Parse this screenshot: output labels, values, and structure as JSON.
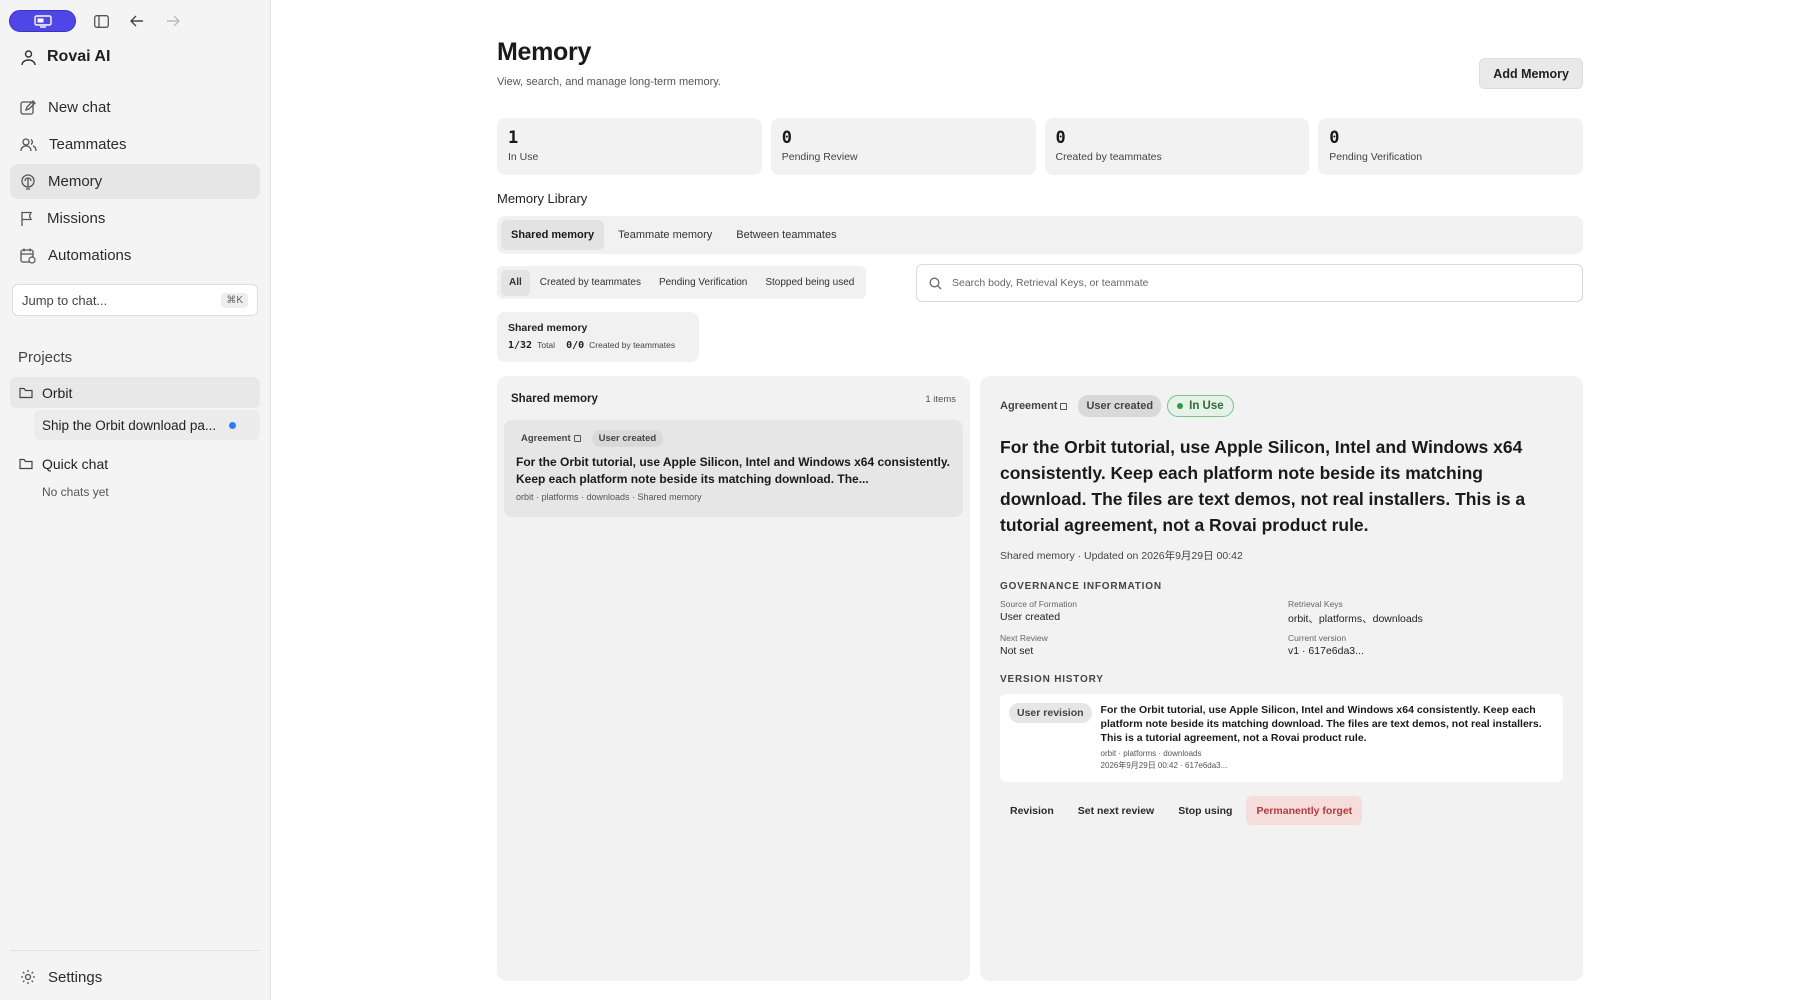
{
  "app": {
    "name": "Rovai AI"
  },
  "colors": {
    "accent": "#4f46e5",
    "in_use": "#2f9a47",
    "danger": "#b33a3a",
    "unread_dot": "#2f7cf6"
  },
  "sidebar": {
    "nav": [
      {
        "label": "New chat",
        "icon": "new-chat-icon"
      },
      {
        "label": "Teammates",
        "icon": "teammates-icon"
      },
      {
        "label": "Memory",
        "icon": "memory-icon"
      },
      {
        "label": "Missions",
        "icon": "flag-icon"
      },
      {
        "label": "Automations",
        "icon": "automations-icon"
      }
    ],
    "jump": {
      "label": "Jump to chat...",
      "shortcut": "⌘K"
    },
    "projects_label": "Projects",
    "projects": [
      {
        "name": "Orbit",
        "chats": [
          "Ship the Orbit download pa..."
        ]
      },
      {
        "name": "Quick chat",
        "empty": "No chats yet"
      }
    ],
    "settings": "Settings"
  },
  "header": {
    "title": "Memory",
    "subtitle": "View, search, and manage long-term memory.",
    "add_button": "Add Memory"
  },
  "stats": [
    {
      "value": "1",
      "label": "In Use"
    },
    {
      "value": "0",
      "label": "Pending Review"
    },
    {
      "value": "0",
      "label": "Created by teammates"
    },
    {
      "value": "0",
      "label": "Pending Verification"
    }
  ],
  "library": {
    "title": "Memory Library",
    "tabs": [
      "Shared memory",
      "Teammate memory",
      "Between teammates"
    ],
    "filters": [
      "All",
      "Created by teammates",
      "Pending Verification",
      "Stopped being used"
    ],
    "search_placeholder": "Search body, Retrieval Keys, or teammate",
    "summary": {
      "title": "Shared memory",
      "total_value": "1/32",
      "total_label": "Total",
      "created_value": "0/0",
      "created_label": "Created by teammates"
    }
  },
  "list": {
    "title": "Shared memory",
    "count": "1 items",
    "items": [
      {
        "type": "Agreement",
        "source": "User created",
        "text": "For the Orbit tutorial, use Apple Silicon, Intel and Windows x64 consistently. Keep each platform note beside its matching download. The...",
        "meta": "orbit · platforms · downloads · Shared memory"
      }
    ]
  },
  "detail": {
    "type": "Agreement",
    "source": "User created",
    "status": "In Use",
    "body": "For the Orbit tutorial, use Apple Silicon, Intel and Windows x64 consistently. Keep each platform note beside its matching download. The files are text demos, not real installers. This is a tutorial agreement, not a Rovai product rule.",
    "updated": "Shared memory · Updated on 2026年9月29日 00:42",
    "governance_title": "GOVERNANCE INFORMATION",
    "governance": [
      {
        "key": "Source of Formation",
        "value": "User created"
      },
      {
        "key": "Retrieval Keys",
        "value": "orbit、platforms、downloads"
      },
      {
        "key": "Next Review",
        "value": "Not set"
      },
      {
        "key": "Current version",
        "value": "v1 · 617e6da3..."
      }
    ],
    "history_title": "VERSION HISTORY",
    "history": [
      {
        "badge": "User revision",
        "body": "For the Orbit tutorial, use Apple Silicon, Intel and Windows x64 consistently. Keep each platform note beside its matching download. The files are text demos, not real installers. This is a tutorial agreement, not a Rovai product rule.",
        "keys": "orbit · platforms · downloads",
        "meta": "2026年9月29日 00:42 · 617e6da3..."
      }
    ],
    "actions": [
      "Revision",
      "Set next review",
      "Stop using",
      "Permanently forget"
    ]
  }
}
